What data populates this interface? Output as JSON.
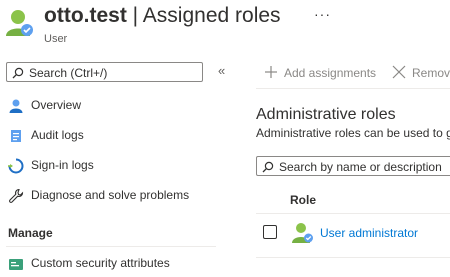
{
  "header": {
    "user_name": "otto.test",
    "separator": " | ",
    "page_name": "Assigned roles",
    "subtitle": "User",
    "more_label": "···"
  },
  "sidebar": {
    "search_placeholder": "Search (Ctrl+/)",
    "collapse_label": "«",
    "items": [
      {
        "label": "Overview",
        "icon": "user-icon"
      },
      {
        "label": "Audit logs",
        "icon": "audit-logs-icon"
      },
      {
        "label": "Sign-in logs",
        "icon": "sign-in-logs-icon"
      },
      {
        "label": "Diagnose and solve problems",
        "icon": "wrench-icon"
      }
    ],
    "section_manage": "Manage",
    "manage_items": [
      {
        "label": "Custom security attributes",
        "icon": "security-attributes-icon"
      }
    ]
  },
  "toolbar": {
    "add_label": "Add assignments",
    "remove_label": "Remov"
  },
  "main": {
    "heading": "Administrative roles",
    "description": "Administrative roles can be used to g",
    "search_placeholder": "Search by name or description",
    "table": {
      "column_role": "Role",
      "rows": [
        {
          "role": "User administrator"
        }
      ]
    }
  },
  "colors": {
    "link": "#0078d4",
    "text": "#323130",
    "muted": "#8a8886",
    "user_icon_body": "#8bc34a",
    "user_icon_badge": "#5ea0ef"
  }
}
